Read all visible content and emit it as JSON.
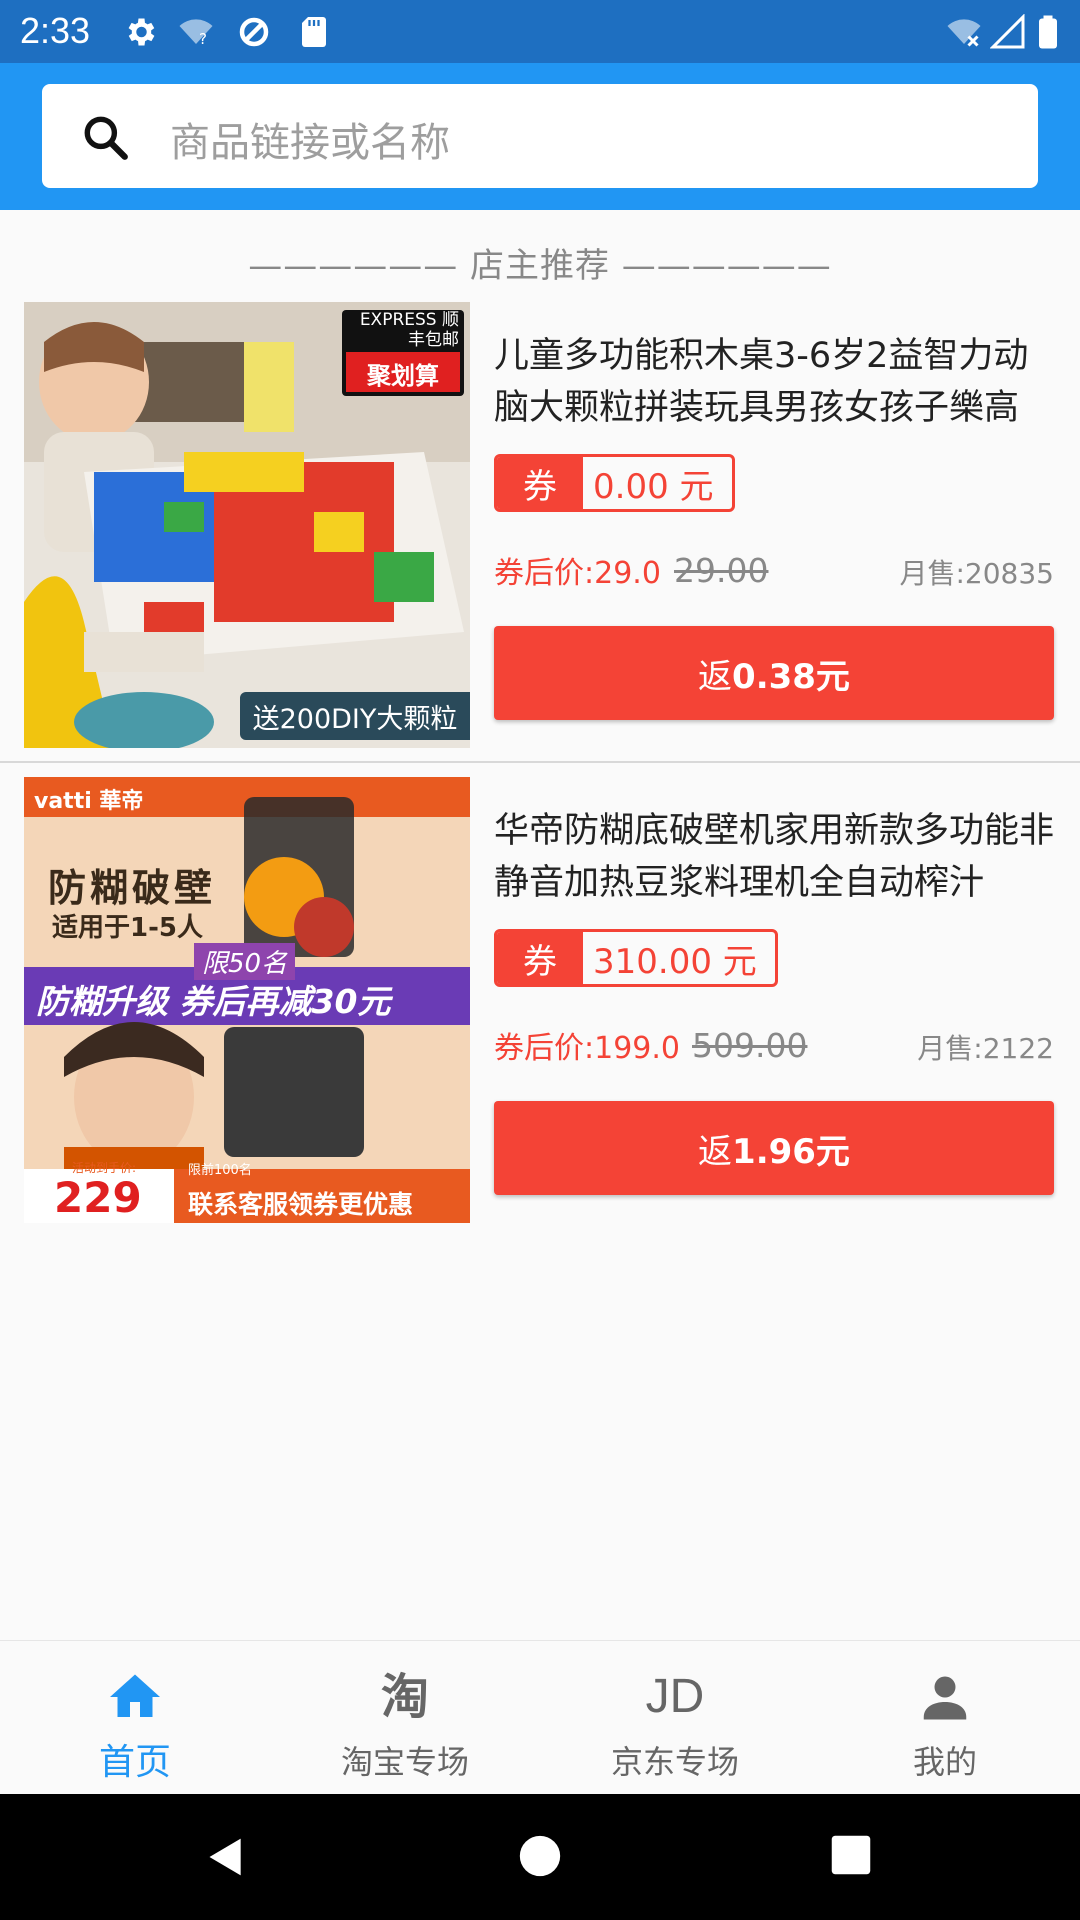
{
  "status_bar": {
    "time": "2:33"
  },
  "search": {
    "placeholder": "商品链接或名称"
  },
  "section": {
    "title": "—————— 店主推荐 ——————"
  },
  "products": [
    {
      "title": "儿童多功能积木桌3-6岁2益智力动脑大颗粒拼装玩具男孩女孩子樂高",
      "coupon_tag": "券",
      "coupon_amount": "0.00 元",
      "after_price": "券后价:29.0",
      "orig_price": "29.00",
      "monthly_sales": "月售:20835",
      "rebate_prefix": "返",
      "rebate_value": "0.38元",
      "image_badge_top": "EXPRESS 顺丰包邮",
      "image_badge_mid": "聚划算",
      "image_caption": "送200DIY大颗粒"
    },
    {
      "title": "华帝防糊底破壁机家用新款多功能非静音加热豆浆料理机全自动榨汁",
      "coupon_tag": "券",
      "coupon_amount": "310.00 元",
      "after_price": "券后价:199.0",
      "orig_price": "509.00",
      "monthly_sales": "月售:2122",
      "rebate_prefix": "返",
      "rebate_value": "1.96元",
      "image_brand": "vatti 華帝",
      "image_head": "防糊破壁",
      "image_sub": "适用于1-5人",
      "image_limit": "限50名",
      "image_banner": "防糊升级 券后再减30元",
      "image_price_label": "活动到手价:",
      "image_price": "229",
      "image_limit_small": "限前100名",
      "image_footer": "联系客服领券更优惠"
    }
  ],
  "bottom_nav": [
    {
      "label": "首页",
      "icon": "home-icon",
      "active": true
    },
    {
      "label": "淘宝专场",
      "icon": "taobao-icon",
      "glyph": "淘"
    },
    {
      "label": "京东专场",
      "icon": "jd-icon",
      "glyph": "JD"
    },
    {
      "label": "我的",
      "icon": "person-icon"
    }
  ],
  "colors": {
    "status_bar": "#1e6fc1",
    "app_bar": "#2196f3",
    "accent_red": "#f44336",
    "active_nav": "#2196f3"
  }
}
